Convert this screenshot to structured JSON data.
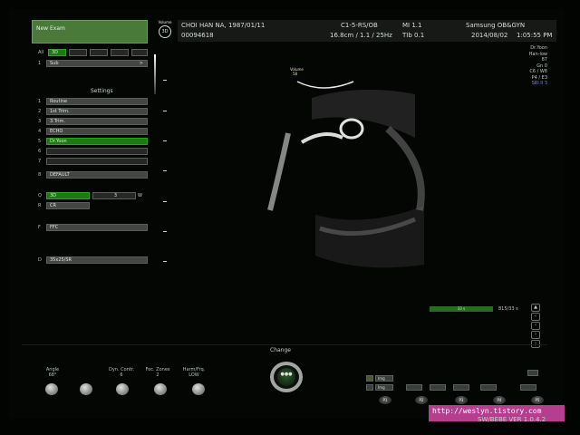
{
  "header": {
    "new_exam": "New Exam",
    "logo_top": "Volume",
    "logo_circle": "3D",
    "patient_name": "CHOI HAN NA,  1987/01/11",
    "patient_id": "00094618",
    "probe": "C1-5-RS/OB",
    "depth_freq": "16.8cm / 1.1 / 25Hz",
    "mi": "MI  1.1",
    "tib": "TIb  0.1",
    "hospital": "Samsung OB&GYN",
    "date": "2014/08/02",
    "time": "1:05:55 PM"
  },
  "stats": {
    "lines": [
      "Dr.Yoon",
      "Han-iow",
      "87",
      "Gn   0",
      "C6 / W8",
      "P4 / E3"
    ],
    "sri": "SRI II 3"
  },
  "left_panel": {
    "row_all": "All",
    "row1_num": "1",
    "row1_label": "Sub",
    "row1_arrow": ">",
    "settings": "Settings",
    "presets": [
      {
        "num": "1",
        "label": "Routine"
      },
      {
        "num": "2",
        "label": "1st Trim."
      },
      {
        "num": "3",
        "label": "3.Trim."
      },
      {
        "num": "4",
        "label": "ECHO"
      },
      {
        "num": "5",
        "label": "Dr.Yoon"
      },
      {
        "num": "6",
        "label": ""
      },
      {
        "num": "7",
        "label": ""
      },
      {
        "num": "8",
        "label": "DEFAULT"
      }
    ],
    "q_label": "Q",
    "q_value": "3D",
    "q_extra": "3",
    "w_label": "W",
    "r_label": "R",
    "r_value": "CR",
    "f_label": "F",
    "f_value": "FFC",
    "d_label": "D",
    "d_value": "35x25/SR"
  },
  "image": {
    "volume_label": "Volume",
    "volume_value": "58"
  },
  "cine": {
    "bar_label": "33 s",
    "counter": "815/33 s"
  },
  "bottom": {
    "knobs": [
      {
        "label": "Angle",
        "value": "68°"
      },
      {
        "label": "",
        "value": ""
      },
      {
        "label": "Dyn. Contr.",
        "value": "6"
      },
      {
        "label": "Foc. Zones",
        "value": "2"
      },
      {
        "label": "Harm/Frq.",
        "value": "LOW"
      }
    ],
    "change": "Change",
    "change_center": "●●●",
    "buttons": [
      "Img",
      "Img"
    ],
    "pbuttons": [
      "P1",
      "P2",
      "P3",
      "P4",
      "P5"
    ]
  },
  "watermark": "http://weslyn.tistory.com",
  "version": "SW/BEBE VER 1.0.4.2",
  "colors": {
    "accent_green": "#1b7a14",
    "watermark": "#b53e8f"
  }
}
